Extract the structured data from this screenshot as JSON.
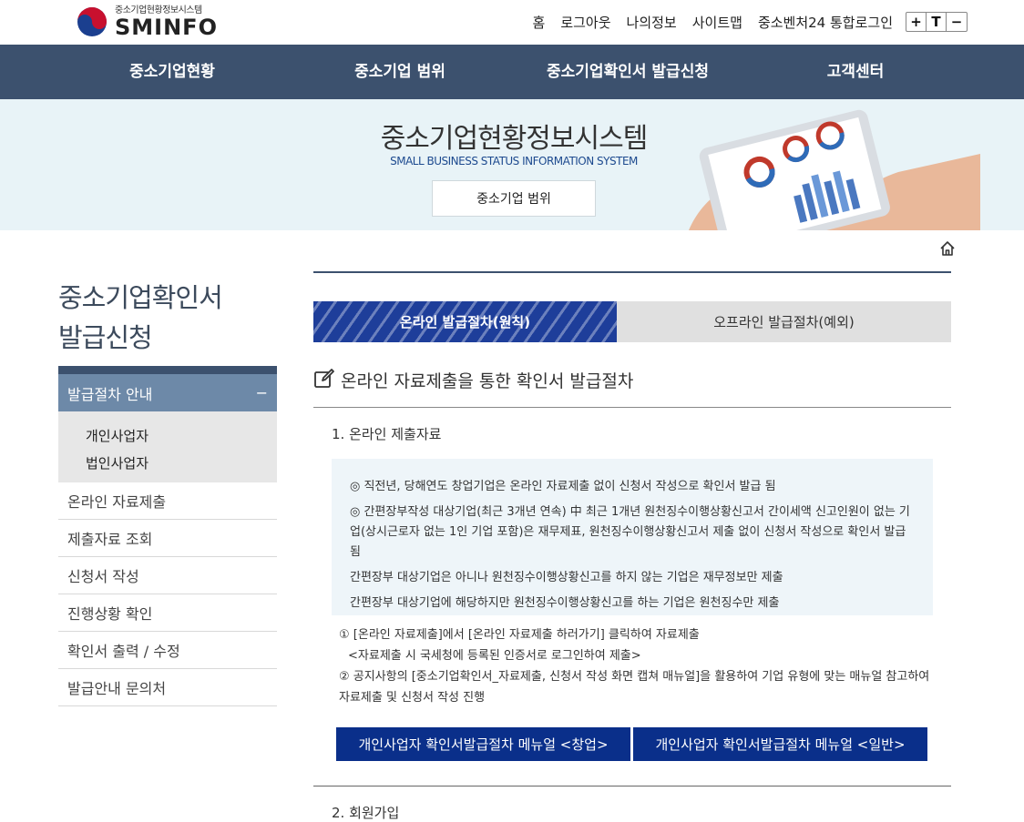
{
  "logo": {
    "subtitle": "중소기업현황정보시스템",
    "name": "SMINFO"
  },
  "util_nav": [
    "홈",
    "로그아웃",
    "나의정보",
    "사이트맵",
    "중소벤처24 통합로그인"
  ],
  "zoom": {
    "in": "+",
    "reset": "T",
    "out": "−"
  },
  "gnb": [
    "중소기업현황",
    "중소기업 범위",
    "중소기업확인서 발급신청",
    "고객센터"
  ],
  "hero": {
    "title": "중소기업현황정보시스템",
    "subtitle": "SMALL BUSINESS STATUS INFORMATION SYSTEM",
    "button": "중소기업 범위"
  },
  "sidebar": {
    "title_line1": "중소기업확인서",
    "title_line2": "발급신청",
    "active": {
      "label": "발급절차 안내",
      "toggle": "−"
    },
    "sub_items": [
      "개인사업자",
      "법인사업자"
    ],
    "items": [
      "온라인 자료제출",
      "제출자료 조회",
      "신청서 작성",
      "진행상황 확인",
      "확인서 출력 / 수정",
      "발급안내 문의처"
    ]
  },
  "tabs": {
    "active": "온라인 발급절차(원칙)",
    "inactive": "오프라인 발급절차(예외)"
  },
  "section": {
    "title": "온라인 자료제출을 통한 확인서 발급절차",
    "sub1": "1. 온라인 제출자료",
    "info": [
      "◎ 직전년, 당해연도 창업기업은 온라인 자료제출 없이 신청서 작성으로 확인서 발급 됨",
      "◎ 간편장부작성 대상기업(최근 3개년 연속) 中 최근 1개년 원천징수이행상황신고서 간이세액 신고인원이 없는 기업(상시근로자 없는 1인 기업 포함)은 재무제표, 원천징수이행상황신고서 제출 없이 신청서 작성으로 확인서 발급 됨",
      "간편장부 대상기업은 아니나 원천징수이행상황신고를 하지 않는 기업은 재무정보만 제출",
      "간편장부 대상기업에 해당하지만 원천징수이행상황신고를 하는 기업은 원천징수만 제출"
    ],
    "step1": "① [온라인 자료제출]에서 [온라인 자료제출 하러가기] 클릭하여 자료제출",
    "step1_note": "<자료제출 시 국세청에 등록된 인증서로 로그인하여 제출>",
    "step2": "② 공지사항의 [중소기업확인서_자료제출, 신청서 작성 화면 캡쳐 매뉴얼]을 활용하여 기업 유형에 맞는 매뉴얼 참고하여 자료제출 및 신청서 작성 진행",
    "btn1": "개인사업자 확인서발급절차 메뉴얼 <창업>",
    "btn2": "개인사업자 확인서발급절차 메뉴얼 <일반>",
    "sub2": "2. 회원가입"
  },
  "colors": {
    "nav": "#3c516e",
    "side_active": "#6d89a8",
    "tab_active": "#1e3e9a",
    "button": "#0a2f8a",
    "hero_bg": "#e8f3f7"
  }
}
